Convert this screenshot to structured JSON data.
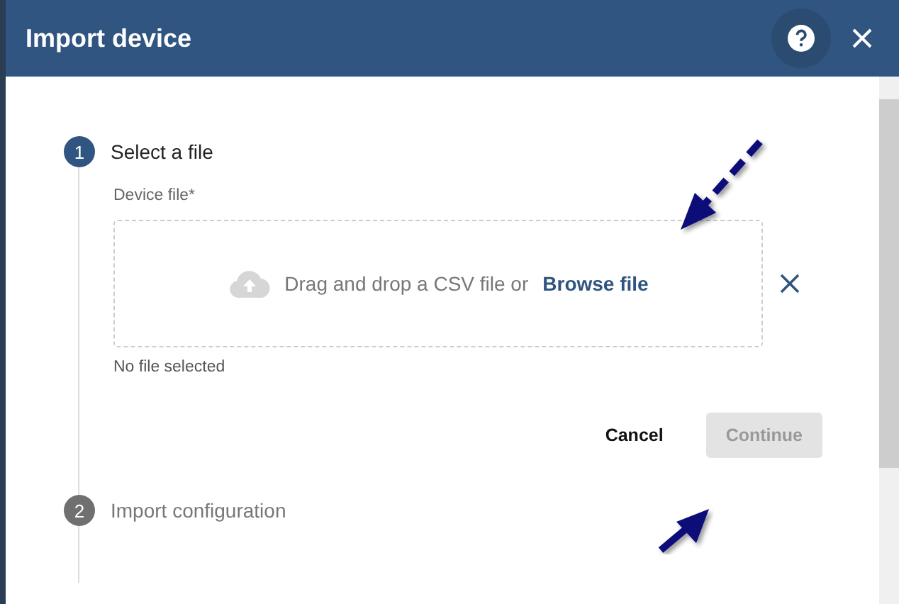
{
  "dialog": {
    "title": "Import device"
  },
  "steps": [
    {
      "number": "1",
      "label": "Select a file",
      "selected": true
    },
    {
      "number": "2",
      "label": "Import configuration",
      "selected": false
    }
  ],
  "file_field": {
    "label": "Device file*",
    "prompt": "Drag and drop a CSV file or",
    "link": "Browse file",
    "status": "No file selected"
  },
  "buttons": [
    {
      "label": "Cancel",
      "kind": "text",
      "disabled": false
    },
    {
      "label": "Continue",
      "kind": "filled",
      "disabled": true
    }
  ]
}
